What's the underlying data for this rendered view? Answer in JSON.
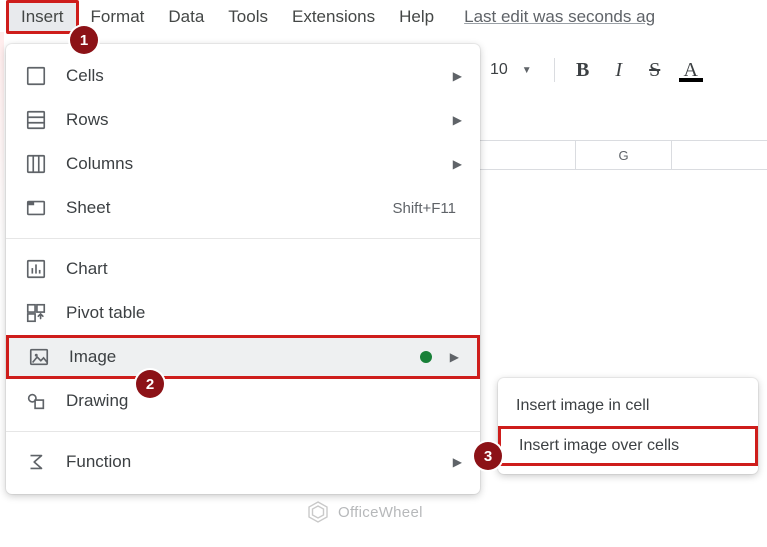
{
  "menubar": {
    "insert_label": "Insert",
    "format_label": "Format",
    "data_label": "Data",
    "tools_label": "Tools",
    "extensions_label": "Extensions",
    "help_label": "Help",
    "revision_link": "Last edit was seconds ag"
  },
  "toolbar": {
    "font_size": "10",
    "bold_glyph": "B",
    "italic_glyph": "I",
    "strike_glyph": "S",
    "textcolor_glyph": "A"
  },
  "columns": {
    "g": "G"
  },
  "dropdown": {
    "cells": "Cells",
    "rows": "Rows",
    "columns": "Columns",
    "sheet": "Sheet",
    "sheet_shortcut": "Shift+F11",
    "chart": "Chart",
    "pivot": "Pivot table",
    "image": "Image",
    "drawing": "Drawing",
    "function": "Function"
  },
  "submenu": {
    "in_cell": "Insert image in cell",
    "over_cells": "Insert image over cells"
  },
  "steps": {
    "s1": "1",
    "s2": "2",
    "s3": "3"
  },
  "watermark": {
    "text": "OfficeWheel"
  }
}
